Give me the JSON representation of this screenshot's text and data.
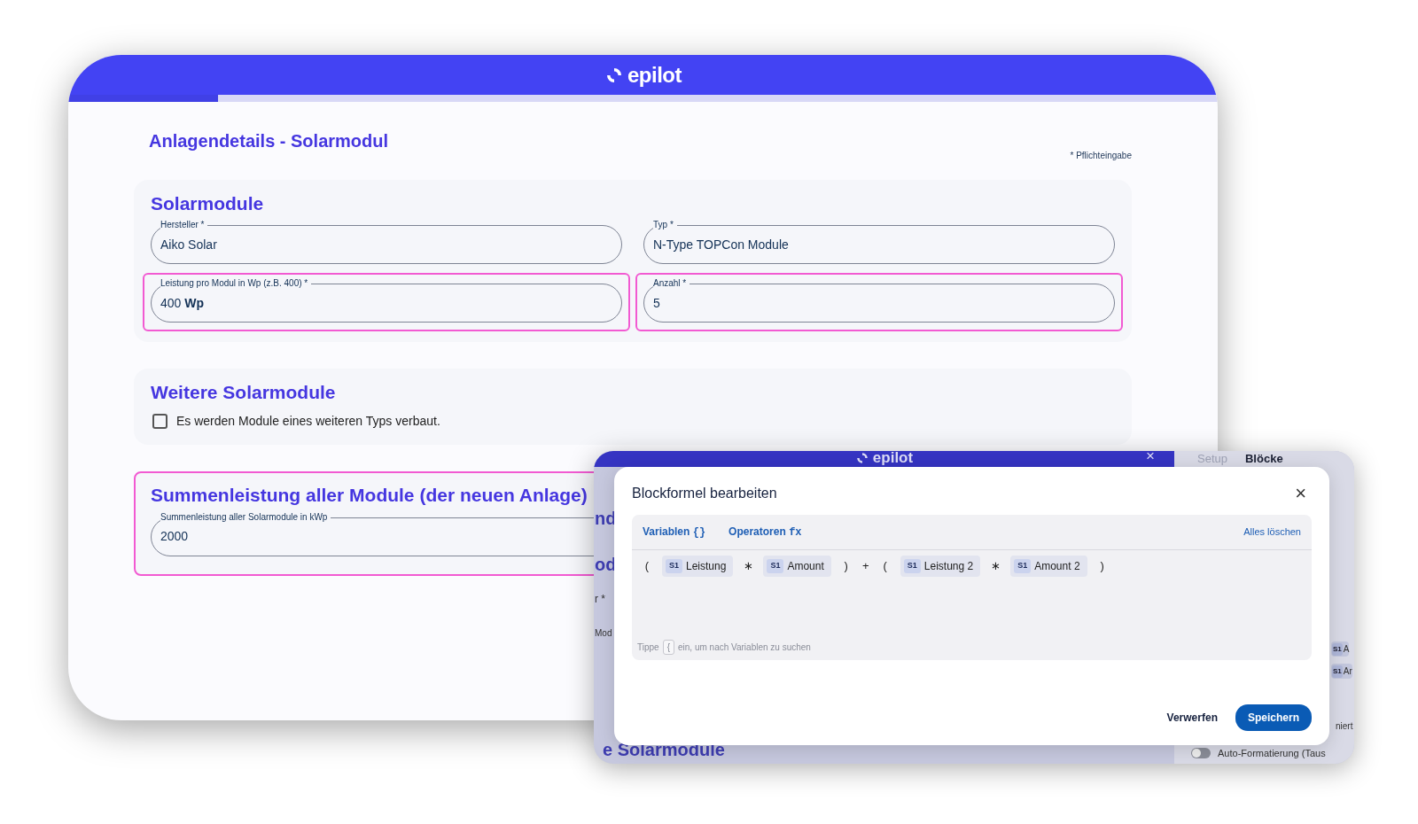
{
  "main_window": {
    "logo": "epilot",
    "progress": {
      "level": 0.13
    },
    "title": "Anlagendetails - Solarmodul",
    "required_note": "* Pflichteingabe",
    "sections": [
      {
        "title": "Solarmodule",
        "highlighted": false,
        "fields": [
          {
            "label": "Hersteller *",
            "value": "Aiko Solar",
            "highlighted": false
          },
          {
            "label": "Typ *",
            "value": "N-Type TOPCon Module",
            "highlighted": false
          },
          {
            "label": "Leistung pro Modul in Wp (z.B. 400) *",
            "value": "400 **Wp**",
            "highlighted": true
          },
          {
            "label": "Anzahl *",
            "value": "5",
            "highlighted": true
          }
        ]
      },
      {
        "title": "Weitere Solarmodule",
        "highlighted": false,
        "checkbox": {
          "label": "Es werden Module eines weiteren Typs verbaut.",
          "checked": false
        }
      },
      {
        "title": "Summenleistung aller Module (der neuen Anlage)",
        "highlighted": true,
        "fields": [
          {
            "label": "Summenleistung aller Solarmodule in kWp",
            "value": "2000",
            "highlighted": false
          }
        ]
      }
    ]
  },
  "back_window": {
    "logo": "epilot",
    "close": "×",
    "tabs": [
      {
        "label": "Setup",
        "selected": false
      },
      {
        "label": "Blöcke",
        "selected": true
      }
    ],
    "fragments": [
      "nd",
      "od",
      "r *",
      "Mod"
    ],
    "bottom_fragment": "e Solarmodule",
    "side_chips": [
      {
        "badge": "S1",
        "text": "A"
      },
      {
        "badge": "S1",
        "text": "Ar"
      }
    ],
    "side_text": "niert",
    "toggle": {
      "label": "Auto-Formatierung (Taus",
      "on": false
    }
  },
  "modal": {
    "title": "Blockformel bearbeiten",
    "close": "×",
    "tabs": [
      {
        "label": "Variablen",
        "symbol": "{}"
      },
      {
        "label": "Operatoren",
        "symbol": "fx"
      }
    ],
    "clear": "Alles löschen",
    "formula": [
      {
        "kind": "op",
        "text": "("
      },
      {
        "kind": "var",
        "badge": "S1",
        "text": "Leistung"
      },
      {
        "kind": "op",
        "text": "∗"
      },
      {
        "kind": "var",
        "badge": "S1",
        "text": "Amount"
      },
      {
        "kind": "op",
        "text": ")"
      },
      {
        "kind": "op",
        "text": "+"
      },
      {
        "kind": "op",
        "text": "("
      },
      {
        "kind": "var",
        "badge": "S1",
        "text": "Leistung 2"
      },
      {
        "kind": "op",
        "text": "∗"
      },
      {
        "kind": "var",
        "badge": "S1",
        "text": "Amount 2"
      },
      {
        "kind": "op",
        "text": ")"
      }
    ],
    "hint": {
      "before": "Tippe",
      "key": "{",
      "after": "ein, um nach Variablen zu suchen"
    },
    "buttons": [
      {
        "label": "Verwerfen",
        "kind": "text"
      },
      {
        "label": "Speichern",
        "kind": "primary"
      }
    ]
  }
}
